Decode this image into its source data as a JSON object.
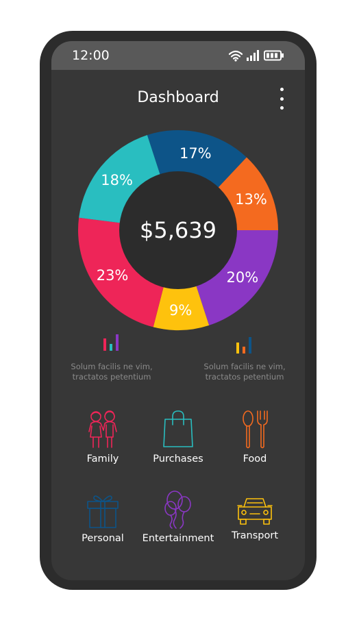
{
  "status_bar": {
    "time": "12:00"
  },
  "header": {
    "title": "Dashboard"
  },
  "chart_data": {
    "type": "pie",
    "center_label": "$5,639",
    "slices": [
      {
        "label": "17%",
        "value": 17,
        "color": "#0d5488"
      },
      {
        "label": "13%",
        "value": 13,
        "color": "#f46a1f"
      },
      {
        "label": "20%",
        "value": 20,
        "color": "#8a37c4"
      },
      {
        "label": "9%",
        "value": 9,
        "color": "#fec20d"
      },
      {
        "label": "23%",
        "value": 23,
        "color": "#ee2558"
      },
      {
        "label": "18%",
        "value": 18,
        "color": "#29bec0"
      }
    ]
  },
  "legends": [
    {
      "icon": "bar-chart-icon",
      "colors": [
        "#ee2558",
        "#29bec0",
        "#8a37c4"
      ],
      "line1": "Solum facilis ne vim,",
      "line2": "tractatos  petentium"
    },
    {
      "icon": "bar-chart-icon",
      "colors": [
        "#fec20d",
        "#f46a1f",
        "#0d5488"
      ],
      "line1": "Solum facilis ne vim,",
      "line2": "tractatos  petentium"
    }
  ],
  "categories": [
    {
      "label": "Family",
      "icon": "family-icon",
      "color": "#ee2558"
    },
    {
      "label": "Purchases",
      "icon": "shopping-bag-icon",
      "color": "#29bec0"
    },
    {
      "label": "Food",
      "icon": "fork-spoon-icon",
      "color": "#f46a1f"
    },
    {
      "label": "Personal",
      "icon": "gift-icon",
      "color": "#0d5488"
    },
    {
      "label": "Entertainment",
      "icon": "balloons-icon",
      "color": "#8a37c4"
    },
    {
      "label": "Transport",
      "icon": "car-icon",
      "color": "#fec20d"
    }
  ]
}
